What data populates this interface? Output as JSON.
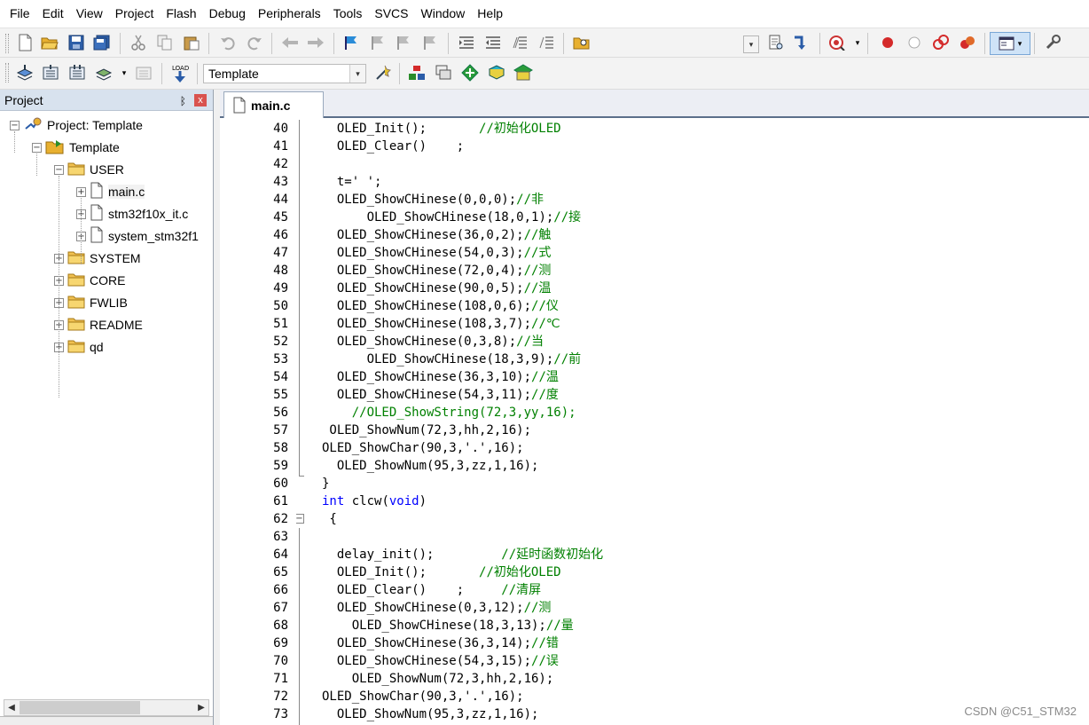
{
  "menu": [
    "File",
    "Edit",
    "View",
    "Project",
    "Flash",
    "Debug",
    "Peripherals",
    "Tools",
    "SVCS",
    "Window",
    "Help"
  ],
  "toolbar2": {
    "target": "Template"
  },
  "project_panel": {
    "title": "Project",
    "pin": "ᛒ",
    "close": "x",
    "tree": [
      {
        "label": "Project: Template",
        "depth": 0,
        "icon": "project-icon",
        "expander": "−"
      },
      {
        "label": "Template",
        "depth": 1,
        "icon": "target-folder-icon",
        "expander": "−"
      },
      {
        "label": "USER",
        "depth": 2,
        "icon": "folder-icon",
        "expander": "−"
      },
      {
        "label": "main.c",
        "depth": 3,
        "icon": "file-icon",
        "expander": "+",
        "selected": true
      },
      {
        "label": "stm32f10x_it.c",
        "depth": 3,
        "icon": "file-icon",
        "expander": "+"
      },
      {
        "label": "system_stm32f1",
        "depth": 3,
        "icon": "file-icon",
        "expander": "+"
      },
      {
        "label": "SYSTEM",
        "depth": 2,
        "icon": "folder-icon",
        "expander": "+"
      },
      {
        "label": "CORE",
        "depth": 2,
        "icon": "folder-icon",
        "expander": "+"
      },
      {
        "label": "FWLIB",
        "depth": 2,
        "icon": "folder-icon",
        "expander": "+"
      },
      {
        "label": "README",
        "depth": 2,
        "icon": "folder-icon",
        "expander": "+"
      },
      {
        "label": "qd",
        "depth": 2,
        "icon": "folder-icon",
        "expander": "+"
      }
    ]
  },
  "editor": {
    "tab": "main.c",
    "lines": [
      {
        "n": "40",
        "indent": 2,
        "segs": [
          [
            "OLED_Init();",
            ""
          ],
          [
            "       //初始化OLED",
            "cm"
          ]
        ]
      },
      {
        "n": "41",
        "indent": 2,
        "segs": [
          [
            "OLED_Clear()    ;",
            ""
          ]
        ]
      },
      {
        "n": "42",
        "indent": 0,
        "segs": []
      },
      {
        "n": "43",
        "indent": 2,
        "segs": [
          [
            "t=' ';",
            ""
          ]
        ]
      },
      {
        "n": "44",
        "indent": 2,
        "segs": [
          [
            "OLED_ShowCHinese(0,0,0);",
            ""
          ],
          [
            "//非",
            "cm"
          ]
        ]
      },
      {
        "n": "45",
        "indent": 6,
        "segs": [
          [
            "OLED_ShowCHinese(18,0,1);",
            ""
          ],
          [
            "//接",
            "cm"
          ]
        ]
      },
      {
        "n": "46",
        "indent": 2,
        "segs": [
          [
            "OLED_ShowCHinese(36,0,2);",
            ""
          ],
          [
            "//触",
            "cm"
          ]
        ]
      },
      {
        "n": "47",
        "indent": 2,
        "segs": [
          [
            "OLED_ShowCHinese(54,0,3);",
            ""
          ],
          [
            "//式",
            "cm"
          ]
        ]
      },
      {
        "n": "48",
        "indent": 2,
        "segs": [
          [
            "OLED_ShowCHinese(72,0,4);",
            ""
          ],
          [
            "//测",
            "cm"
          ]
        ]
      },
      {
        "n": "49",
        "indent": 2,
        "segs": [
          [
            "OLED_ShowCHinese(90,0,5);",
            ""
          ],
          [
            "//温",
            "cm"
          ]
        ]
      },
      {
        "n": "50",
        "indent": 2,
        "segs": [
          [
            "OLED_ShowCHinese(108,0,6);",
            ""
          ],
          [
            "//仪",
            "cm"
          ]
        ]
      },
      {
        "n": "51",
        "indent": 2,
        "segs": [
          [
            "OLED_ShowCHinese(108,3,7);",
            ""
          ],
          [
            "//℃",
            "cm"
          ]
        ]
      },
      {
        "n": "52",
        "indent": 2,
        "segs": [
          [
            "OLED_ShowCHinese(0,3,8);",
            ""
          ],
          [
            "//当",
            "cm"
          ]
        ]
      },
      {
        "n": "53",
        "indent": 6,
        "segs": [
          [
            "OLED_ShowCHinese(18,3,9);",
            ""
          ],
          [
            "//前",
            "cm"
          ]
        ]
      },
      {
        "n": "54",
        "indent": 2,
        "segs": [
          [
            "OLED_ShowCHinese(36,3,10);",
            ""
          ],
          [
            "//温",
            "cm"
          ]
        ]
      },
      {
        "n": "55",
        "indent": 2,
        "segs": [
          [
            "OLED_ShowCHinese(54,3,11);",
            ""
          ],
          [
            "//度",
            "cm"
          ]
        ]
      },
      {
        "n": "56",
        "indent": 4,
        "segs": [
          [
            "//OLED_ShowString(72,3,yy,16);",
            "cm"
          ]
        ]
      },
      {
        "n": "57",
        "indent": 1,
        "segs": [
          [
            "OLED_ShowNum(72,3,hh,2,16);",
            ""
          ]
        ]
      },
      {
        "n": "58",
        "indent": 0,
        "segs": [
          [
            "OLED_ShowChar(90,3,'.',16);",
            ""
          ]
        ]
      },
      {
        "n": "59",
        "indent": 2,
        "segs": [
          [
            "OLED_ShowNum(95,3,zz,1,16);",
            ""
          ]
        ]
      },
      {
        "n": "60",
        "indent": 0,
        "segs": [
          [
            "}",
            ""
          ]
        ]
      },
      {
        "n": "61",
        "indent": 0,
        "segs": [
          [
            "int",
            "kw"
          ],
          [
            " clcw(",
            ""
          ],
          [
            "void",
            "kw"
          ],
          [
            ")",
            ""
          ]
        ]
      },
      {
        "n": "62",
        "indent": 0,
        "segs": [
          [
            " {",
            ""
          ]
        ]
      },
      {
        "n": "63",
        "indent": 0,
        "segs": []
      },
      {
        "n": "64",
        "indent": 2,
        "segs": [
          [
            "delay_init();",
            ""
          ],
          [
            "         //延时函数初始化",
            "cm"
          ]
        ]
      },
      {
        "n": "65",
        "indent": 2,
        "segs": [
          [
            "OLED_Init();",
            ""
          ],
          [
            "       //初始化OLED",
            "cm"
          ]
        ]
      },
      {
        "n": "66",
        "indent": 2,
        "segs": [
          [
            "OLED_Clear()    ;     ",
            ""
          ],
          [
            "//清屏",
            "cm"
          ]
        ]
      },
      {
        "n": "67",
        "indent": 2,
        "segs": [
          [
            "OLED_ShowCHinese(0,3,12);",
            ""
          ],
          [
            "//测",
            "cm"
          ]
        ]
      },
      {
        "n": "68",
        "indent": 4,
        "segs": [
          [
            "OLED_ShowCHinese(18,3,13);",
            ""
          ],
          [
            "//量",
            "cm"
          ]
        ]
      },
      {
        "n": "69",
        "indent": 2,
        "segs": [
          [
            "OLED_ShowCHinese(36,3,14);",
            ""
          ],
          [
            "//错",
            "cm"
          ]
        ]
      },
      {
        "n": "70",
        "indent": 2,
        "segs": [
          [
            "OLED_ShowCHinese(54,3,15);",
            ""
          ],
          [
            "//误",
            "cm"
          ]
        ]
      },
      {
        "n": "71",
        "indent": 4,
        "segs": [
          [
            "OLED_ShowNum(72,3,hh,2,16);",
            ""
          ]
        ]
      },
      {
        "n": "72",
        "indent": 0,
        "segs": [
          [
            "OLED_ShowChar(90,3,'.',16);",
            ""
          ]
        ]
      },
      {
        "n": "73",
        "indent": 2,
        "segs": [
          [
            "OLED_ShowNum(95,3,zz,1,16);",
            ""
          ]
        ]
      }
    ]
  },
  "watermark": "CSDN @C51_STM32"
}
